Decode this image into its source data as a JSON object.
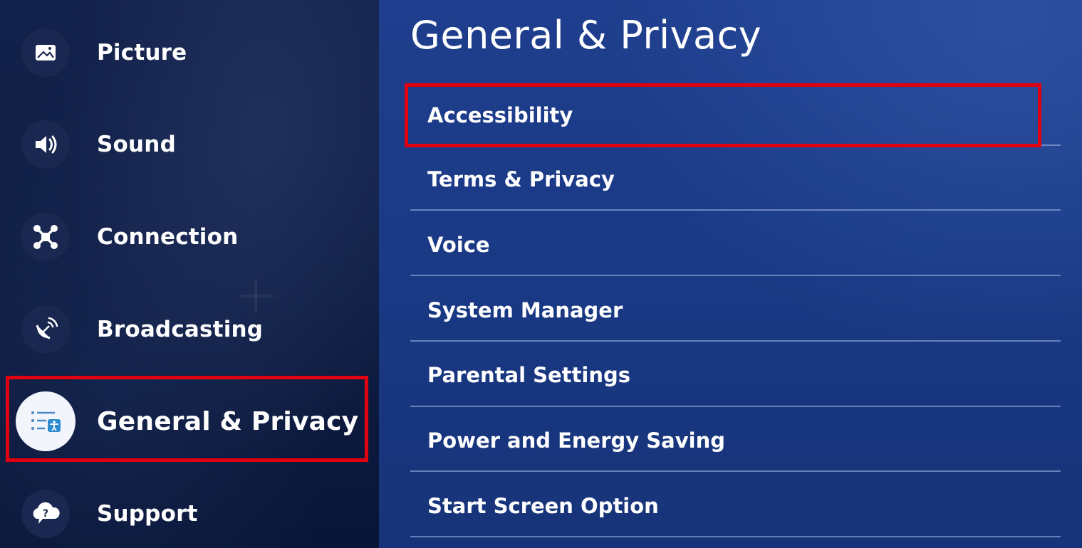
{
  "sidebar": {
    "items": [
      {
        "label": "Picture",
        "icon": "picture-icon"
      },
      {
        "label": "Sound",
        "icon": "speaker-icon"
      },
      {
        "label": "Connection",
        "icon": "network-icon"
      },
      {
        "label": "Broadcasting",
        "icon": "satellite-dish-icon"
      },
      {
        "label": "General & Privacy",
        "icon": "general-settings-icon",
        "selected": true
      },
      {
        "label": "Support",
        "icon": "help-cloud-icon"
      }
    ]
  },
  "main": {
    "title": "General & Privacy",
    "items": [
      {
        "label": "Accessibility",
        "highlighted": true
      },
      {
        "label": "Terms & Privacy"
      },
      {
        "label": "Voice"
      },
      {
        "label": "System Manager"
      },
      {
        "label": "Parental Settings"
      },
      {
        "label": "Power and Energy Saving"
      },
      {
        "label": "Start Screen Option"
      }
    ]
  },
  "colors": {
    "highlight_border": "#e1000f",
    "main_panel": "#1f3f8e",
    "sidebar_panel": "#13224b",
    "text": "#ffffff"
  }
}
